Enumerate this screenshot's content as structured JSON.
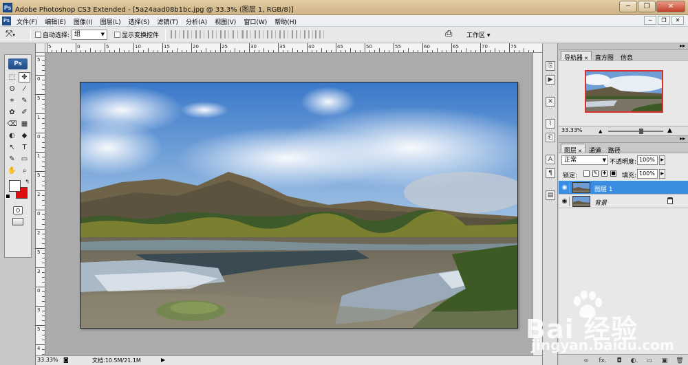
{
  "window": {
    "title": "Adobe Photoshop CS3 Extended - [5a24aad08b1bc.jpg @ 33.3% (图层 1, RGB/8)]",
    "badge": "Ps",
    "minimize": "─",
    "restore": "❐",
    "close": "✕"
  },
  "menu": {
    "items": [
      "文件(F)",
      "编辑(E)",
      "图像(I)",
      "图层(L)",
      "选择(S)",
      "滤镜(T)",
      "分析(A)",
      "视图(V)",
      "窗口(W)",
      "帮助(H)"
    ],
    "mdi": [
      "─",
      "❐",
      "✕"
    ]
  },
  "options": {
    "auto_select_label": "自动选择:",
    "auto_select_value": "组",
    "show_transform_label": "显示变换控件",
    "workspace_label": "工作区 ▾"
  },
  "toolbox": {
    "logo": "Ps",
    "tools": [
      "⬚",
      "✥",
      "ʘ",
      "⁄",
      "⌗",
      "✎",
      "✿",
      "✐",
      "⌫",
      "▦",
      "◐",
      "◆",
      "↖",
      "T",
      "✎",
      "▭",
      "✋",
      "⌕"
    ]
  },
  "rulers": {
    "top": [
      "5",
      "0",
      "5",
      "10",
      "15",
      "20",
      "25",
      "30",
      "35",
      "40",
      "45",
      "50",
      "55",
      "60",
      "65",
      "70",
      "75"
    ],
    "left": [
      "5",
      "0",
      "5",
      "1",
      "0",
      "1",
      "5",
      "2",
      "0",
      "2",
      "5",
      "3",
      "0",
      "3",
      "5",
      "4"
    ]
  },
  "status": {
    "zoom": "33.33%",
    "doc": "文档:10.5M/21.1M"
  },
  "navigator": {
    "tabs": [
      "导航器",
      "直方图",
      "信息"
    ],
    "zoom": "33.33%"
  },
  "layers": {
    "tabs": [
      "图层",
      "通道",
      "路径"
    ],
    "blend_mode": "正常",
    "opacity_label": "不透明度:",
    "opacity_value": "100%",
    "lock_label": "锁定:",
    "fill_label": "填充:",
    "fill_value": "100%",
    "items": [
      {
        "name": "图层 1"
      },
      {
        "name": "背景"
      }
    ],
    "footer_icons": [
      "∞",
      "fx.",
      "◘",
      "◐.",
      "▭",
      "▣",
      "🗑"
    ]
  },
  "watermark": {
    "brand": "Bai 经验",
    "url": "jingyan.baidu.com"
  }
}
